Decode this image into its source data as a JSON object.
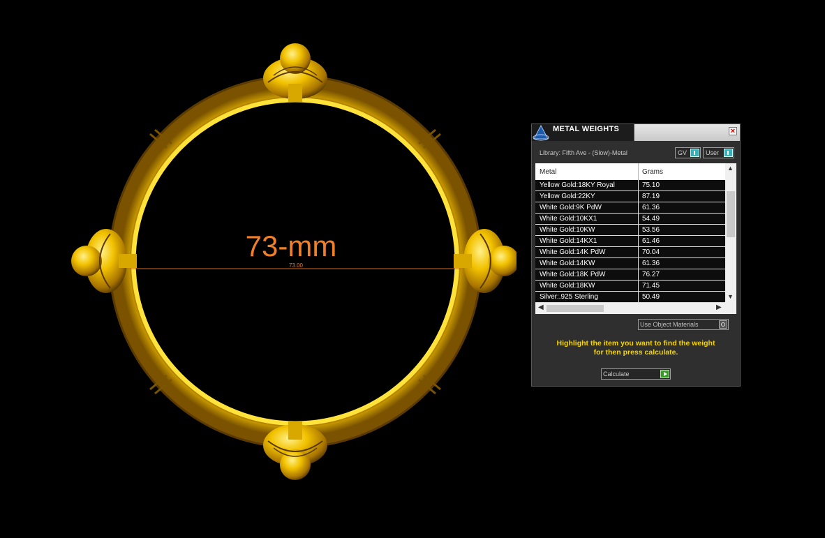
{
  "viewport": {
    "dimension_label": "73-mm",
    "dimension_value": "73.00",
    "colors": {
      "metal_dark": "#8a5a00",
      "metal_mid": "#d9a300",
      "metal_light": "#ffe04d",
      "dimension_text": "#f07f2a",
      "dimension_line": "#d86a1e"
    }
  },
  "panel": {
    "title": "METAL WEIGHTS",
    "close_label": "×",
    "library": "Library: Fifth Ave - (Slow)-Metal",
    "toggle_gv_label": "GV",
    "toggle_user_label": "User",
    "table": {
      "columns": [
        "Metal",
        "Grams"
      ],
      "rows": [
        {
          "metal": "Yellow Gold:18KY Royal",
          "grams": "75.10"
        },
        {
          "metal": "Yellow Gold:22KY",
          "grams": "87.19"
        },
        {
          "metal": "White Gold:9K PdW",
          "grams": "61.36"
        },
        {
          "metal": "White Gold:10KX1",
          "grams": "54.49"
        },
        {
          "metal": "White Gold:10KW",
          "grams": "53.56"
        },
        {
          "metal": "White Gold:14KX1",
          "grams": "61.46"
        },
        {
          "metal": "White Gold:14K PdW",
          "grams": "70.04"
        },
        {
          "metal": "White Gold:14KW",
          "grams": "61.36"
        },
        {
          "metal": "White Gold:18K PdW",
          "grams": "76.27"
        },
        {
          "metal": "White Gold:18KW",
          "grams": "71.45"
        },
        {
          "metal": "Silver:.925 Sterling",
          "grams": "50.49"
        }
      ]
    },
    "use_object_materials_label": "Use Object Materials",
    "instruction_line1": "Highlight the item you want to find the weight",
    "instruction_line2": "for then press calculate.",
    "calculate_label": "Calculate",
    "accent_color": "#f5d400"
  }
}
